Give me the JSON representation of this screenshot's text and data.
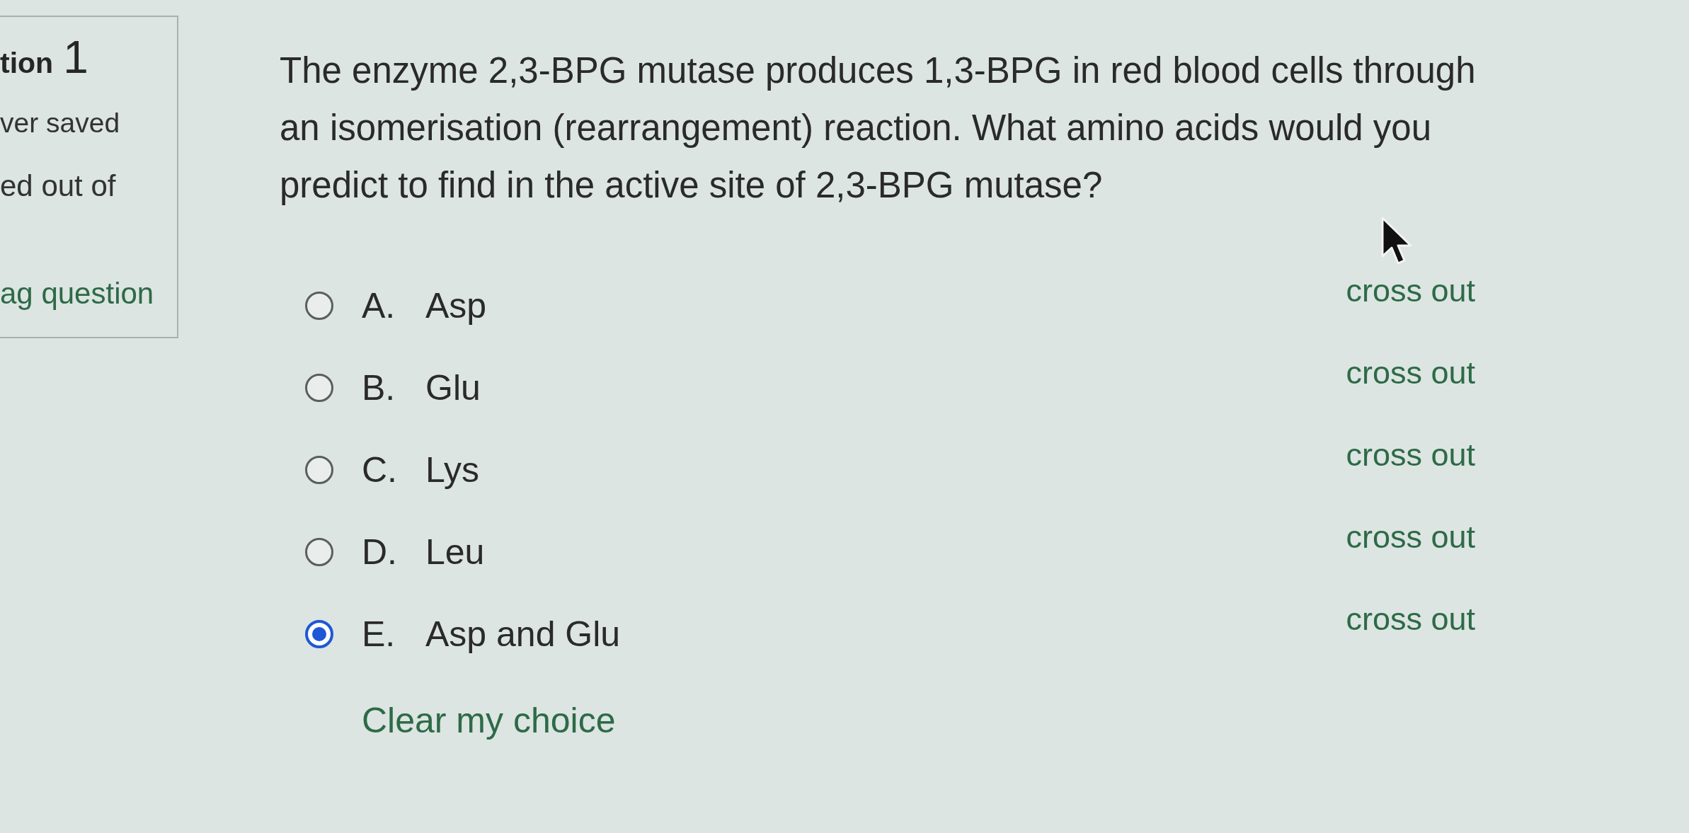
{
  "question_info": {
    "heading": "tion",
    "number": "1",
    "status": "ver saved",
    "mark": "ed out of",
    "flag_link": "ag question"
  },
  "question": {
    "text": "The enzyme 2,3-BPG mutase produces 1,3-BPG in red blood cells through an isomerisation (rearrangement) reaction. What amino acids would you predict to find in the active site of 2,3-BPG mutase?",
    "options": [
      {
        "letter": "A.",
        "text": "Asp",
        "selected": false,
        "cross_out": "cross out"
      },
      {
        "letter": "B.",
        "text": "Glu",
        "selected": false,
        "cross_out": "cross out"
      },
      {
        "letter": "C.",
        "text": "Lys",
        "selected": false,
        "cross_out": "cross out"
      },
      {
        "letter": "D.",
        "text": "Leu",
        "selected": false,
        "cross_out": "cross out"
      },
      {
        "letter": "E.",
        "text": "Asp and Glu",
        "selected": true,
        "cross_out": "cross out"
      }
    ],
    "clear_link": "Clear my choice"
  }
}
